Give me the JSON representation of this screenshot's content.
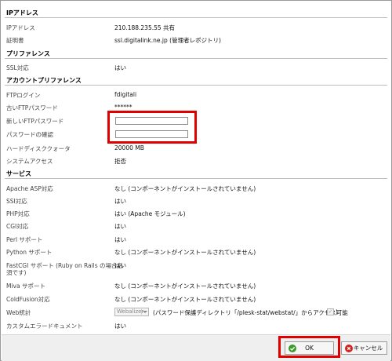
{
  "sections": {
    "ip": "IPアドレス",
    "pref": "プリファレンス",
    "account": "アカウントプリファレンス",
    "services": "サービス"
  },
  "rows": {
    "ip_label": "IPアドレス",
    "ip_value": "210.188.235.55 共有",
    "cert_label": "証明書",
    "cert_value": "ssl.digitalink.ne.jp (管理者レポジトリ)",
    "ssl_label": "SSL対応",
    "ssl_value": "はい",
    "ftp_login_label": "FTPログイン",
    "ftp_login_value": "fdigitali",
    "old_pw_label": "古いFTPパスワード",
    "old_pw_value": "******",
    "new_pw_label": "新しいFTPパスワード",
    "confirm_pw_label": "パスワードの確認",
    "quota_label": "ハードディスククォータ",
    "quota_value": "20000 MB",
    "sysaccess_label": "システムアクセス",
    "sysaccess_value": "拒否",
    "asp_label": "Apache ASP対応",
    "asp_value": "なし (コンポーネントがインストールされていません)",
    "ssi_label": "SSI対応",
    "ssi_value": "はい",
    "php_label": "PHP対応",
    "php_value": "はい (Apache モジュール)",
    "cgi_label": "CGI対応",
    "cgi_value": "はい",
    "perl_label": "Perl サポート",
    "perl_value": "はい",
    "python_label": "Python サポート",
    "python_value": "なし (コンポーネントがインストールされていません)",
    "fastcgi_label_1": "FastCGI サポート (Ruby on Rails の場合必",
    "fastcgi_label_2": "須です)",
    "fastcgi_value": "はい",
    "miva_label": "Miva サポート",
    "miva_value": "なし (コンポーネントがインストールされていません)",
    "coldfusion_label": "ColdFusion対応",
    "coldfusion_value": "なし (コンポーネントがインストールされていません)",
    "webstats_label": "Web統計",
    "webstats_select": "Webalizer",
    "webstats_note": "(パスワード保護ディレクトリ「/plesk-stat/webstat/」からアクセス可能",
    "webstats_close": ")",
    "custom_error_label": "カスタムエラードキュメント",
    "custom_error_value": "はい"
  },
  "buttons": {
    "ok": "OK",
    "cancel": "キャンセル"
  },
  "colors": {
    "highlight": "#e00000",
    "ok_icon": "#3a9a2a",
    "cancel_icon": "#d42020"
  },
  "icons": {
    "ok": "check-circle-icon",
    "cancel": "x-circle-icon"
  }
}
